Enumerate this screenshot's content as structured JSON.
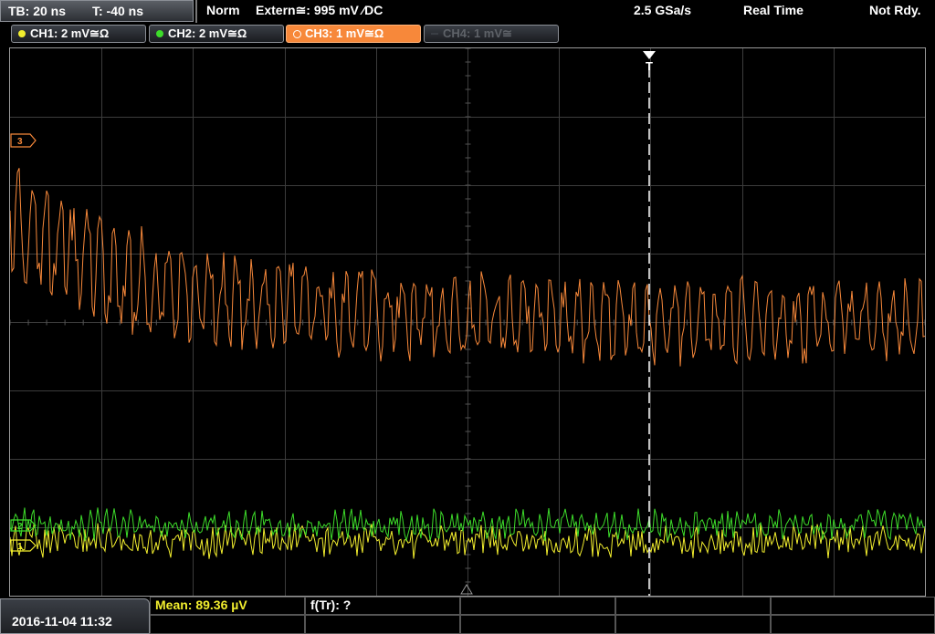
{
  "timebase": {
    "tb_label": "TB: 20 ns",
    "trig_offset_label": "T: -40 ns"
  },
  "status": {
    "mode": "Norm",
    "trigger": "Extern≅: 995 mV ⁄DC",
    "sample_rate": "2.5 GSa/s",
    "acq_mode": "Real Time",
    "state": "Not Rdy."
  },
  "channels": [
    {
      "label": "CH1: 2 mV≅Ω",
      "color": "#f2ee2e"
    },
    {
      "label": "CH2: 2 mV≅Ω",
      "color": "#3ddc2a"
    },
    {
      "label": "CH3: 1 mV≅Ω",
      "color": "#f7883a"
    },
    {
      "label": "CH4: 1 mV≅",
      "color": "#5e6268"
    }
  ],
  "markers": {
    "ch3": "3",
    "ch2": "2",
    "ch1": "1",
    "trigger": "T"
  },
  "measurements": {
    "mean": "Mean: 89.36 µV",
    "f_tr": "f(Tr): ?"
  },
  "datetime": "2016-11-04 11:32",
  "colors": {
    "ch1": "#f2ee2e",
    "ch2": "#3ddc2a",
    "ch3": "#f7883a",
    "grid": "#3c3c3c"
  }
}
